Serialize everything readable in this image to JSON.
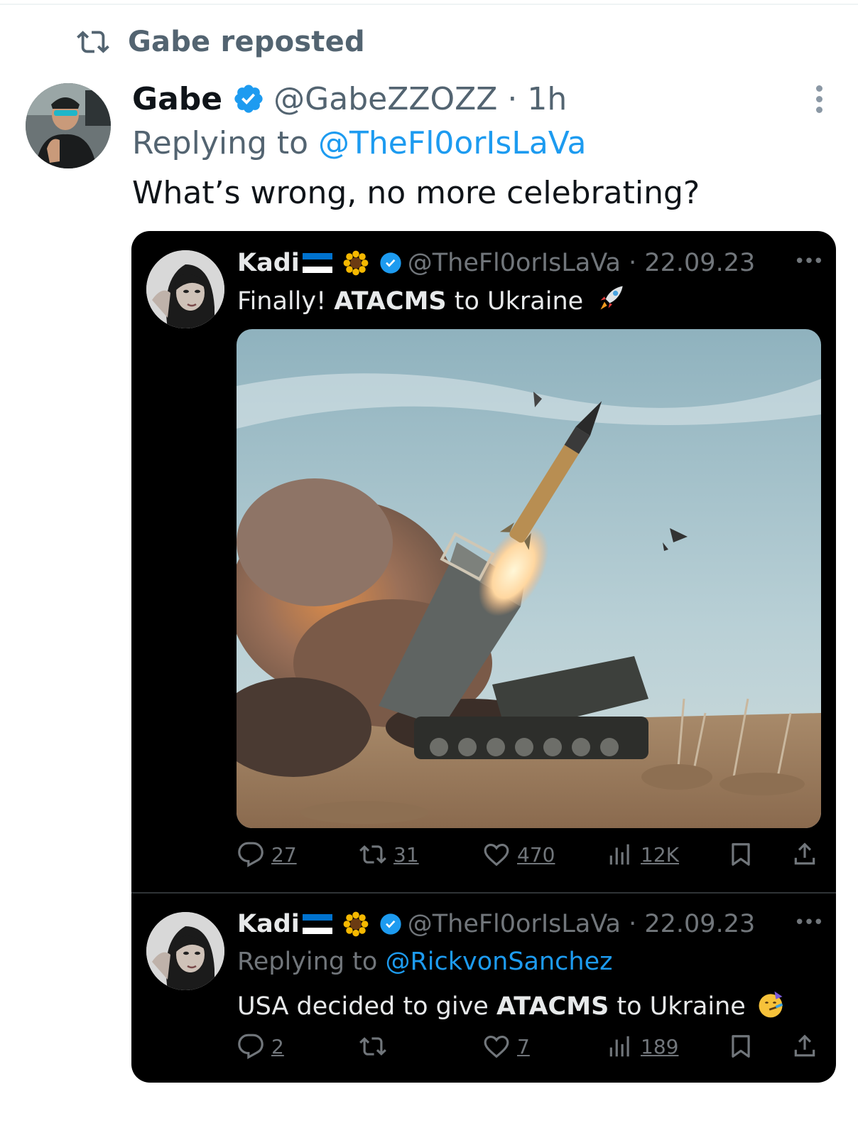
{
  "repost_banner": {
    "icon": "repost-icon",
    "text": "Gabe reposted"
  },
  "tweet": {
    "author_name": "Gabe",
    "author_handle": "@GabeZZOZZ · 1h",
    "replying_prefix": "Replying to ",
    "replying_to": "@TheFl0orIsLaVa",
    "text": "What’s wrong, no more celebrating?"
  },
  "embedded": {
    "post1": {
      "name": "Kadi",
      "handle": "@TheFl0orIsLaVa · 22.09.23",
      "text_prefix": "Finally! ",
      "text_bold": "ATACMS",
      "text_suffix": " to Ukraine",
      "emoji": "rocket",
      "image_alt": "ATACMS missile launching from a tracked launcher vehicle in the desert",
      "stats": {
        "replies": "27",
        "reposts": "31",
        "likes": "470",
        "views": "12K"
      }
    },
    "post2": {
      "name": "Kadi",
      "handle": "@TheFl0orIsLaVa · 22.09.23",
      "replying_prefix": "Replying to ",
      "replying_to": "@RickvonSanchez",
      "text_prefix": "USA decided to give ",
      "text_bold": "ATACMS",
      "text_suffix": " to Ukraine",
      "emoji": "partying-face",
      "stats": {
        "replies": "2",
        "reposts": "",
        "likes": "7",
        "views": "189"
      }
    },
    "flag_colors": [
      "#0072ce",
      "#000000",
      "#ffffff"
    ]
  },
  "colors": {
    "accent": "#1d9bf0",
    "muted": "#536471",
    "dark_bg": "#000000"
  }
}
